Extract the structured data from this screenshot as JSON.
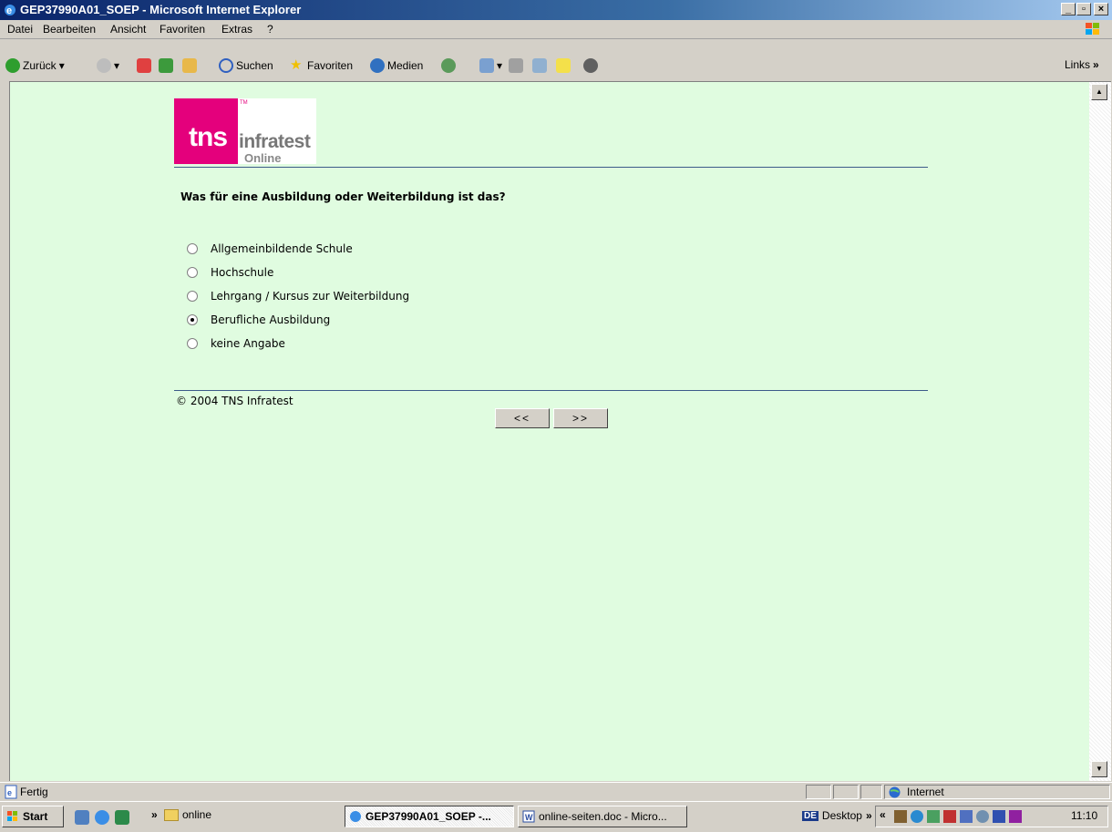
{
  "window": {
    "title": "GEP37990A01_SOEP - Microsoft Internet Explorer"
  },
  "menu": [
    "Datei",
    "Bearbeiten",
    "Ansicht",
    "Favoriten",
    "Extras",
    "?"
  ],
  "toolbar": {
    "back": "Zurück",
    "search": "Suchen",
    "favorites": "Favoriten",
    "media": "Medien",
    "links": "Links"
  },
  "logo": {
    "tns": "tns",
    "infratest": "infratest",
    "online": "Online",
    "tm": "TM"
  },
  "survey": {
    "question": "Was für eine Ausbildung oder Weiterbildung ist das?",
    "options": [
      {
        "label": "Allgemeinbildende Schule",
        "checked": false
      },
      {
        "label": "Hochschule",
        "checked": false
      },
      {
        "label": "Lehrgang / Kursus zur Weiterbildung",
        "checked": false
      },
      {
        "label": "Berufliche Ausbildung",
        "checked": true
      },
      {
        "label": "keine Angabe",
        "checked": false
      }
    ],
    "copyright": "© 2004 TNS Infratest",
    "back_button": "<<",
    "next_button": ">>"
  },
  "status": {
    "text": "Fertig",
    "zone": "Internet"
  },
  "taskbar": {
    "start": "Start",
    "quick_more": "»",
    "folder": "online",
    "task_ie": "GEP37990A01_SOEP -...",
    "task_word": "online-seiten.doc - Micro...",
    "lang": "DE",
    "desktop": "Desktop",
    "clock": "11:10"
  },
  "colors": {
    "page_bg": "#e0fce0",
    "brand_pink": "#e4007c",
    "rule": "#3c5a8a"
  }
}
